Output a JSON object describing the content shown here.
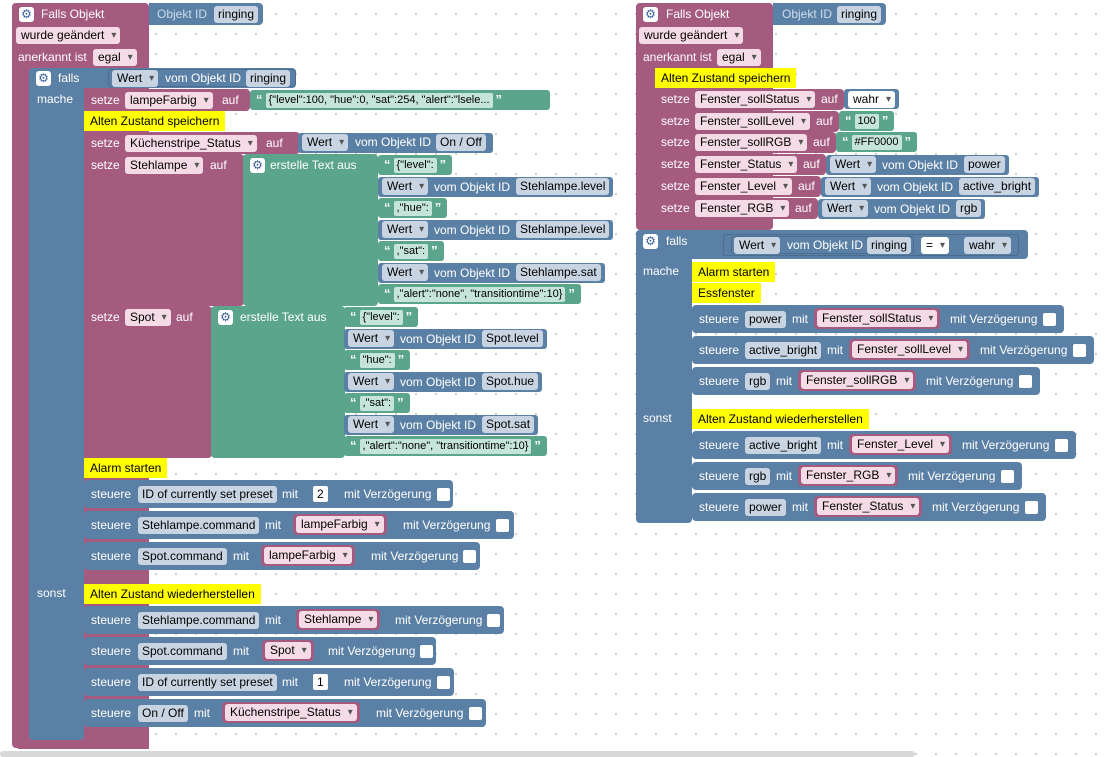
{
  "labels": {
    "falls_objekt": "Falls Objekt",
    "objekt_id": "Objekt ID",
    "wurde": "wurde",
    "anerkannt_ist": "anerkannt ist",
    "falls": "falls",
    "mache": "mache",
    "sonst": "sonst",
    "setze": "setze",
    "auf": "auf",
    "vom_objekt_id": "vom Objekt ID",
    "erstelle_text_aus": "erstelle Text aus",
    "steuere": "steuere",
    "mit": "mit",
    "mit_verzoegerung": "mit Verzögerung",
    "eq": "=",
    "quote_open": "“",
    "quote_close": "”"
  },
  "trigger": {
    "object_id": "ringing",
    "change": "wurde geändert",
    "ack": "egal"
  },
  "left": {
    "cond_attr": "Wert",
    "cond_oid": "ringing",
    "set1_var": "lampeFarbig",
    "set1_val": "{\"level\":100, \"hue\":0, \"sat\":254, \"alert\":\"lsele...",
    "c_save": "Alten Zustand speichern",
    "set2_var": "Küchenstripe_Status",
    "set2_attr": "Wert",
    "set2_oid": "On / Off",
    "set3_var": "Stehlampe",
    "t1": [
      {
        "kind": "text",
        "value": "{\"level\":"
      },
      {
        "kind": "get",
        "attr": "Wert",
        "oid": "Stehlampe.level"
      },
      {
        "kind": "text",
        "value": ",\"hue\":"
      },
      {
        "kind": "get",
        "attr": "Wert",
        "oid": "Stehlampe.level"
      },
      {
        "kind": "text",
        "value": ",\"sat\":"
      },
      {
        "kind": "get",
        "attr": "Wert",
        "oid": "Stehlampe.sat"
      },
      {
        "kind": "text",
        "value": ",\"alert\":\"none\", \"transitiontime\":10}"
      }
    ],
    "set4_var": "Spot",
    "t2": [
      {
        "kind": "text",
        "value": "{\"level\":"
      },
      {
        "kind": "get",
        "attr": "Wert",
        "oid": "Spot.level"
      },
      {
        "kind": "text",
        "value": "\"hue\":"
      },
      {
        "kind": "get",
        "attr": "Wert",
        "oid": "Spot.hue"
      },
      {
        "kind": "text",
        "value": ",\"sat\":"
      },
      {
        "kind": "get",
        "attr": "Wert",
        "oid": "Spot.sat"
      },
      {
        "kind": "text",
        "value": ",\"alert\":\"none\", \"transitiontime\":10}"
      }
    ],
    "c_alarm": "Alarm starten",
    "s1_oid": "ID of currently set preset",
    "s1_val": "2",
    "s2_oid": "Stehlampe.command",
    "s2_val": "lampeFarbig",
    "s3_oid": "Spot.command",
    "s3_val": "lampeFarbig",
    "c_restore": "Alten Zustand wiederherstellen",
    "r1_oid": "Stehlampe.command",
    "r1_val": "Stehlampe",
    "r2_oid": "Spot.command",
    "r2_val": "Spot",
    "r3_oid": "ID of currently set preset",
    "r3_val": "1",
    "r4_oid": "On / Off",
    "r4_val": "Küchenstripe_Status"
  },
  "right": {
    "c_save": "Alten Zustand speichern",
    "sets": [
      {
        "var": "Fenster_sollStatus",
        "kind": "dropdown",
        "value": "wahr"
      },
      {
        "var": "Fenster_sollLevel",
        "kind": "number",
        "value": "100"
      },
      {
        "var": "Fenster_sollRGB",
        "kind": "text",
        "value": "#FF0000"
      },
      {
        "var": "Fenster_Status",
        "kind": "get",
        "attr": "Wert",
        "oid": "power"
      },
      {
        "var": "Fenster_Level",
        "kind": "get",
        "attr": "Wert",
        "oid": "active_bright"
      },
      {
        "var": "Fenster_RGB",
        "kind": "get",
        "attr": "Wert",
        "oid": "rgb"
      }
    ],
    "cond_attr": "Wert",
    "cond_oid": "ringing",
    "cond_rhs": "wahr",
    "c_alarm": "Alarm starten",
    "c_essfenster": "Essfenster",
    "s": [
      {
        "oid": "power",
        "var": "Fenster_sollStatus"
      },
      {
        "oid": "active_bright",
        "var": "Fenster_sollLevel"
      },
      {
        "oid": "rgb",
        "var": "Fenster_sollRGB"
      }
    ],
    "c_restore": "Alten Zustand wiederherstellen",
    "r": [
      {
        "oid": "active_bright",
        "var": "Fenster_Level"
      },
      {
        "oid": "rgb",
        "var": "Fenster_RGB"
      },
      {
        "oid": "power",
        "var": "Fenster_Status"
      }
    ]
  }
}
